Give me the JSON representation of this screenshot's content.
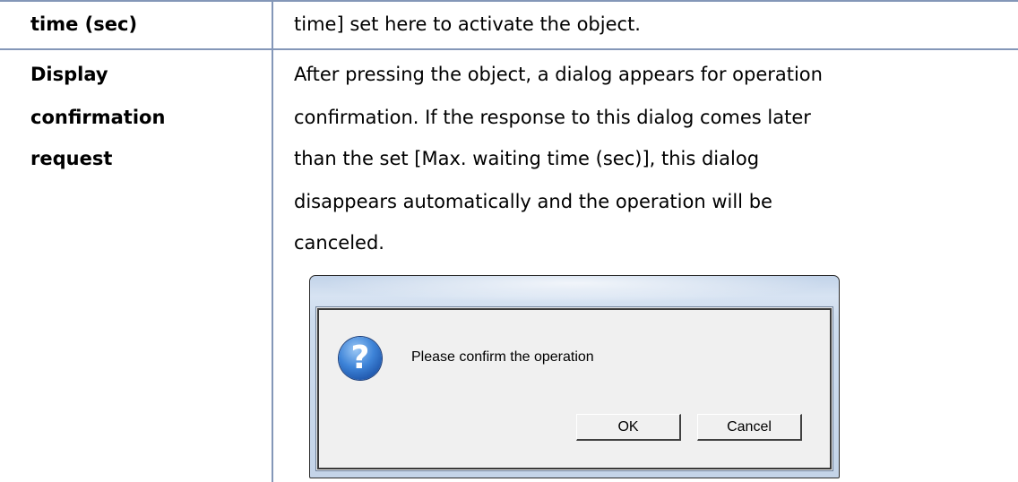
{
  "table": {
    "row1": {
      "label": "time (sec)",
      "description": "time] set here to activate the object."
    },
    "row2": {
      "label_lines": [
        "Display",
        "confirmation",
        "request"
      ],
      "description_lines": [
        "After pressing the object, a dialog appears for operation",
        "confirmation. If the response to this dialog comes later",
        "than the set [Max. waiting time (sec)], this dialog",
        "disappears automatically and the operation will be",
        "canceled."
      ]
    }
  },
  "dialog": {
    "icon": "question-icon",
    "icon_glyph": "?",
    "message": "Please confirm the operation",
    "ok_label": "OK",
    "cancel_label": "Cancel"
  },
  "colors": {
    "table_rule": "#8497b8",
    "dialog_frame": "#c4d4e8",
    "icon_blue": "#3e84d8"
  }
}
